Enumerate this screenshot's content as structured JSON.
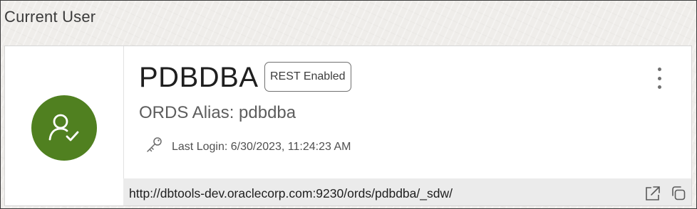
{
  "section": {
    "title": "Current User"
  },
  "user": {
    "name": "PDBDBA",
    "badge": "REST Enabled",
    "alias_text": "ORDS Alias: pdbdba",
    "last_login": "Last Login: 6/30/2023, 11:24:23 AM",
    "url": "http://dbtools-dev.oraclecorp.com:9230/ords/pdbdba/_sdw/"
  },
  "icons": {
    "avatar": "user-check-icon",
    "menu": "kebab-menu-icon",
    "login": "key-icon",
    "open": "external-link-icon",
    "copy": "copy-icon"
  },
  "colors": {
    "avatar_bg": "#508020",
    "url_bar_bg": "#ebebeb"
  }
}
